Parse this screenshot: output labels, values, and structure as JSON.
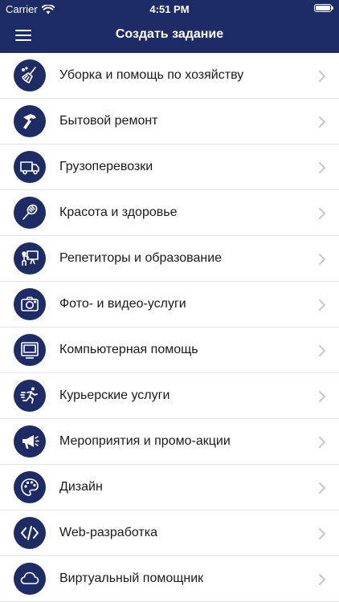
{
  "status_bar": {
    "carrier": "Carrier",
    "time": "4:51 PM",
    "battery_level": 1.0
  },
  "nav": {
    "title": "Создать задание",
    "menu_icon": "hamburger-menu-icon"
  },
  "colors": {
    "navy": "#1d2c64",
    "separator": "#e3e3e6",
    "chevron": "#c7c7cc"
  },
  "categories": [
    {
      "label": "Уборка и помощь по хозяйству",
      "icon": "broom-icon"
    },
    {
      "label": "Бытовой ремонт",
      "icon": "hammer-icon"
    },
    {
      "label": "Грузоперевозки",
      "icon": "truck-icon"
    },
    {
      "label": "Красота и здоровье",
      "icon": "hairbrush-icon"
    },
    {
      "label": "Репетиторы и образование",
      "icon": "teacher-board-icon"
    },
    {
      "label": "Фото- и видео-услуги",
      "icon": "camera-icon"
    },
    {
      "label": "Компьютерная помощь",
      "icon": "monitor-icon"
    },
    {
      "label": "Курьерские услуги",
      "icon": "running-courier-icon"
    },
    {
      "label": "Мероприятия и промо-акции",
      "icon": "megaphone-icon"
    },
    {
      "label": "Дизайн",
      "icon": "palette-icon"
    },
    {
      "label": "Web-разработка",
      "icon": "code-brackets-icon"
    },
    {
      "label": "Виртуальный помощник",
      "icon": "cloud-icon"
    }
  ]
}
